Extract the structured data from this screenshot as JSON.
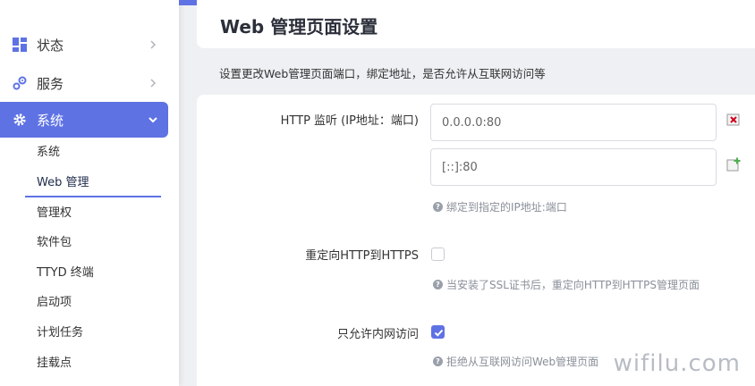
{
  "sidebar": {
    "main_items": [
      {
        "label": "状态",
        "icon": "dashboard-icon"
      },
      {
        "label": "服务",
        "icon": "puzzle-icon"
      },
      {
        "label": "系统",
        "icon": "gear-icon"
      }
    ],
    "sub_items": [
      {
        "label": "系统"
      },
      {
        "label": "Web 管理"
      },
      {
        "label": "管理权"
      },
      {
        "label": "软件包"
      },
      {
        "label": "TTYD 终端"
      },
      {
        "label": "启动项"
      },
      {
        "label": "计划任务"
      },
      {
        "label": "挂载点"
      }
    ]
  },
  "main": {
    "title": "Web 管理页面设置",
    "description": "设置更改Web管理页面端口，绑定地址，是否允许从互联网访问等",
    "fields": {
      "http_listen": {
        "label": "HTTP 监听 (IP地址：端口)",
        "values": [
          "0.0.0.0:80",
          "[::]:80"
        ],
        "hint": "绑定到指定的IP地址:端口"
      },
      "redirect_https": {
        "label": "重定向HTTP到HTTPS",
        "checked": false,
        "hint": "当安装了SSL证书后，重定向HTTP到HTTPS管理页面"
      },
      "lan_only": {
        "label": "只允许内网访问",
        "checked": true,
        "hint": "拒绝从互联网访问Web管理页面"
      }
    }
  },
  "watermark": "wifilu.com",
  "colors": {
    "accent": "#5e72e4",
    "background": "#eef0f3"
  }
}
